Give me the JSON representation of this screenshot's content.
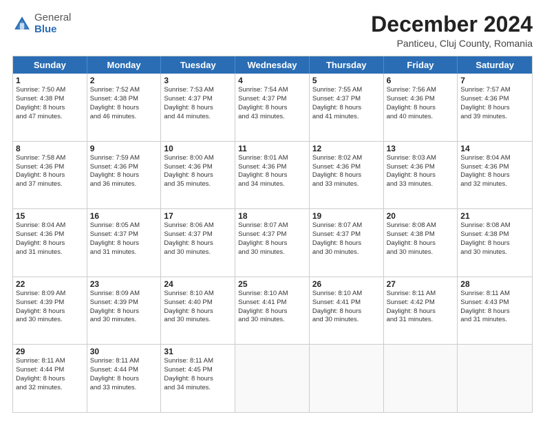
{
  "header": {
    "logo_general": "General",
    "logo_blue": "Blue",
    "month": "December 2024",
    "location": "Panticeu, Cluj County, Romania"
  },
  "weekdays": [
    "Sunday",
    "Monday",
    "Tuesday",
    "Wednesday",
    "Thursday",
    "Friday",
    "Saturday"
  ],
  "rows": [
    [
      {
        "day": "1",
        "l1": "Sunrise: 7:50 AM",
        "l2": "Sunset: 4:38 PM",
        "l3": "Daylight: 8 hours",
        "l4": "and 47 minutes."
      },
      {
        "day": "2",
        "l1": "Sunrise: 7:52 AM",
        "l2": "Sunset: 4:38 PM",
        "l3": "Daylight: 8 hours",
        "l4": "and 46 minutes."
      },
      {
        "day": "3",
        "l1": "Sunrise: 7:53 AM",
        "l2": "Sunset: 4:37 PM",
        "l3": "Daylight: 8 hours",
        "l4": "and 44 minutes."
      },
      {
        "day": "4",
        "l1": "Sunrise: 7:54 AM",
        "l2": "Sunset: 4:37 PM",
        "l3": "Daylight: 8 hours",
        "l4": "and 43 minutes."
      },
      {
        "day": "5",
        "l1": "Sunrise: 7:55 AM",
        "l2": "Sunset: 4:37 PM",
        "l3": "Daylight: 8 hours",
        "l4": "and 41 minutes."
      },
      {
        "day": "6",
        "l1": "Sunrise: 7:56 AM",
        "l2": "Sunset: 4:36 PM",
        "l3": "Daylight: 8 hours",
        "l4": "and 40 minutes."
      },
      {
        "day": "7",
        "l1": "Sunrise: 7:57 AM",
        "l2": "Sunset: 4:36 PM",
        "l3": "Daylight: 8 hours",
        "l4": "and 39 minutes."
      }
    ],
    [
      {
        "day": "8",
        "l1": "Sunrise: 7:58 AM",
        "l2": "Sunset: 4:36 PM",
        "l3": "Daylight: 8 hours",
        "l4": "and 37 minutes."
      },
      {
        "day": "9",
        "l1": "Sunrise: 7:59 AM",
        "l2": "Sunset: 4:36 PM",
        "l3": "Daylight: 8 hours",
        "l4": "and 36 minutes."
      },
      {
        "day": "10",
        "l1": "Sunrise: 8:00 AM",
        "l2": "Sunset: 4:36 PM",
        "l3": "Daylight: 8 hours",
        "l4": "and 35 minutes."
      },
      {
        "day": "11",
        "l1": "Sunrise: 8:01 AM",
        "l2": "Sunset: 4:36 PM",
        "l3": "Daylight: 8 hours",
        "l4": "and 34 minutes."
      },
      {
        "day": "12",
        "l1": "Sunrise: 8:02 AM",
        "l2": "Sunset: 4:36 PM",
        "l3": "Daylight: 8 hours",
        "l4": "and 33 minutes."
      },
      {
        "day": "13",
        "l1": "Sunrise: 8:03 AM",
        "l2": "Sunset: 4:36 PM",
        "l3": "Daylight: 8 hours",
        "l4": "and 33 minutes."
      },
      {
        "day": "14",
        "l1": "Sunrise: 8:04 AM",
        "l2": "Sunset: 4:36 PM",
        "l3": "Daylight: 8 hours",
        "l4": "and 32 minutes."
      }
    ],
    [
      {
        "day": "15",
        "l1": "Sunrise: 8:04 AM",
        "l2": "Sunset: 4:36 PM",
        "l3": "Daylight: 8 hours",
        "l4": "and 31 minutes."
      },
      {
        "day": "16",
        "l1": "Sunrise: 8:05 AM",
        "l2": "Sunset: 4:37 PM",
        "l3": "Daylight: 8 hours",
        "l4": "and 31 minutes."
      },
      {
        "day": "17",
        "l1": "Sunrise: 8:06 AM",
        "l2": "Sunset: 4:37 PM",
        "l3": "Daylight: 8 hours",
        "l4": "and 30 minutes."
      },
      {
        "day": "18",
        "l1": "Sunrise: 8:07 AM",
        "l2": "Sunset: 4:37 PM",
        "l3": "Daylight: 8 hours",
        "l4": "and 30 minutes."
      },
      {
        "day": "19",
        "l1": "Sunrise: 8:07 AM",
        "l2": "Sunset: 4:37 PM",
        "l3": "Daylight: 8 hours",
        "l4": "and 30 minutes."
      },
      {
        "day": "20",
        "l1": "Sunrise: 8:08 AM",
        "l2": "Sunset: 4:38 PM",
        "l3": "Daylight: 8 hours",
        "l4": "and 30 minutes."
      },
      {
        "day": "21",
        "l1": "Sunrise: 8:08 AM",
        "l2": "Sunset: 4:38 PM",
        "l3": "Daylight: 8 hours",
        "l4": "and 30 minutes."
      }
    ],
    [
      {
        "day": "22",
        "l1": "Sunrise: 8:09 AM",
        "l2": "Sunset: 4:39 PM",
        "l3": "Daylight: 8 hours",
        "l4": "and 30 minutes."
      },
      {
        "day": "23",
        "l1": "Sunrise: 8:09 AM",
        "l2": "Sunset: 4:39 PM",
        "l3": "Daylight: 8 hours",
        "l4": "and 30 minutes."
      },
      {
        "day": "24",
        "l1": "Sunrise: 8:10 AM",
        "l2": "Sunset: 4:40 PM",
        "l3": "Daylight: 8 hours",
        "l4": "and 30 minutes."
      },
      {
        "day": "25",
        "l1": "Sunrise: 8:10 AM",
        "l2": "Sunset: 4:41 PM",
        "l3": "Daylight: 8 hours",
        "l4": "and 30 minutes."
      },
      {
        "day": "26",
        "l1": "Sunrise: 8:10 AM",
        "l2": "Sunset: 4:41 PM",
        "l3": "Daylight: 8 hours",
        "l4": "and 30 minutes."
      },
      {
        "day": "27",
        "l1": "Sunrise: 8:11 AM",
        "l2": "Sunset: 4:42 PM",
        "l3": "Daylight: 8 hours",
        "l4": "and 31 minutes."
      },
      {
        "day": "28",
        "l1": "Sunrise: 8:11 AM",
        "l2": "Sunset: 4:43 PM",
        "l3": "Daylight: 8 hours",
        "l4": "and 31 minutes."
      }
    ],
    [
      {
        "day": "29",
        "l1": "Sunrise: 8:11 AM",
        "l2": "Sunset: 4:44 PM",
        "l3": "Daylight: 8 hours",
        "l4": "and 32 minutes."
      },
      {
        "day": "30",
        "l1": "Sunrise: 8:11 AM",
        "l2": "Sunset: 4:44 PM",
        "l3": "Daylight: 8 hours",
        "l4": "and 33 minutes."
      },
      {
        "day": "31",
        "l1": "Sunrise: 8:11 AM",
        "l2": "Sunset: 4:45 PM",
        "l3": "Daylight: 8 hours",
        "l4": "and 34 minutes."
      },
      null,
      null,
      null,
      null
    ]
  ]
}
